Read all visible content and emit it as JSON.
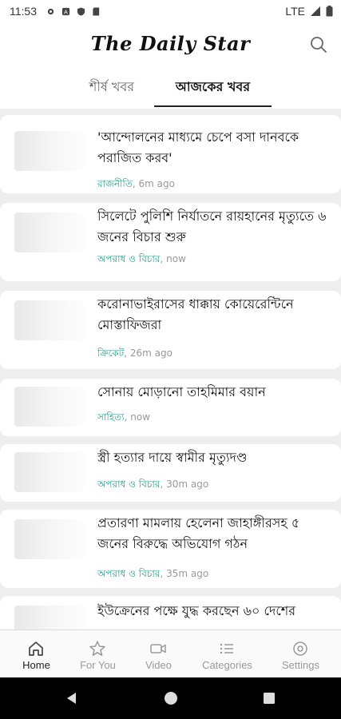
{
  "status_bar": {
    "time": "11:53",
    "left_icons": [
      "settings-gear-icon",
      "notification-a-icon",
      "shield-icon",
      "sd-card-icon"
    ],
    "network": "LTE",
    "right_icons": [
      "signal-icon",
      "battery-icon"
    ]
  },
  "header": {
    "logo": "The Daily Star",
    "search_icon": "search-icon"
  },
  "tabs": [
    {
      "label": "শীর্ষ খবর",
      "active": false
    },
    {
      "label": "আজকের খবর",
      "active": true
    }
  ],
  "articles": [
    {
      "title": "'আন্দোলনের মাধ্যমে চেপে বসা দানবকে পরাজিত করব'",
      "category": "রাজনীতি",
      "time": "6m ago"
    },
    {
      "title": "সিলেটে পুলিশি নির্যাতনে রায়হানের মৃত্যুতে ৬ জনের বিচার শুরু",
      "category": "অপরাধ ও বিচার",
      "time": "now"
    },
    {
      "title": "করোনাভাইরাসের ধাক্কায় কোয়েরেন্টিনে মোস্তাফিজরা",
      "category": "ক্রিকেট",
      "time": "26m ago"
    },
    {
      "title": "সোনায় মোড়ানো তাহমিমার বয়ান",
      "category": "সাহিত্য",
      "time": "now"
    },
    {
      "title": "স্ত্রী হত্যার দায়ে স্বামীর মৃত্যুদণ্ড",
      "category": "অপরাধ ও বিচার",
      "time": "30m ago"
    },
    {
      "title": "প্রতারণা মামলায় হেলেনা জাহাঙ্গীরসহ ৫ জনের বিরুদ্ধে অভিযোগ গঠন",
      "category": "অপরাধ ও বিচার",
      "time": "35m ago"
    },
    {
      "title": "ইউক্রেনের পক্ষে যুদ্ধ করছেন ৬০ দেশের",
      "category": "",
      "time": ""
    }
  ],
  "bottom_nav": [
    {
      "label": "Home",
      "icon": "home-icon",
      "active": true
    },
    {
      "label": "For You",
      "icon": "star-icon",
      "active": false
    },
    {
      "label": "Video",
      "icon": "video-camera-icon",
      "active": false
    },
    {
      "label": "Categories",
      "icon": "list-icon",
      "active": false
    },
    {
      "label": "Settings",
      "icon": "settings-icon",
      "active": false
    }
  ],
  "system_nav": [
    "back-icon",
    "home-circle-icon",
    "recents-icon"
  ],
  "colors": {
    "category_accent": "#2a9a8a",
    "feed_background": "#eeeeee",
    "meta_gray": "#999999"
  }
}
